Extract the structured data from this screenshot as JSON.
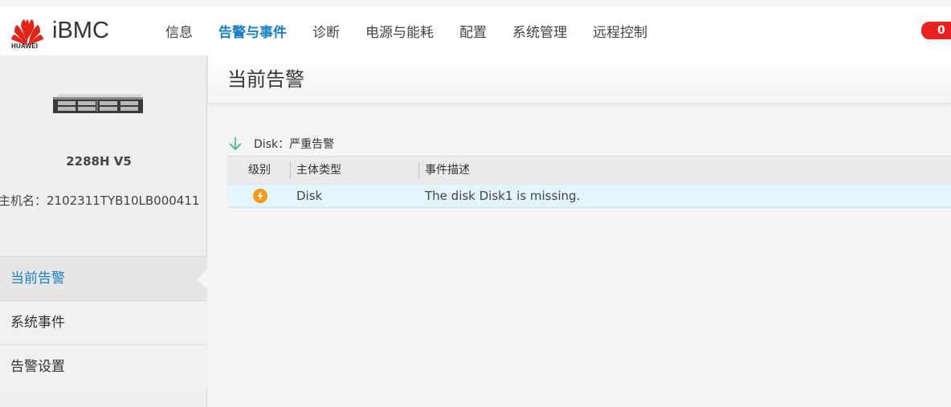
{
  "header": {
    "logo_text": "HUAWEI",
    "brand": "iBMC",
    "nav": [
      "信息",
      "告警与事件",
      "诊断",
      "电源与能耗",
      "配置",
      "系统管理",
      "远程控制"
    ],
    "active_nav": "告警与事件",
    "alert_count": "0"
  },
  "sidebar": {
    "model": "2288H V5",
    "hostname": "主机名：2102311TYB10LB000411",
    "items": [
      {
        "label": "当前告警"
      },
      {
        "label": "系统事件"
      },
      {
        "label": "告警设置"
      }
    ]
  },
  "main": {
    "title": "当前告警",
    "group_label": "Disk：严重告警",
    "columns": [
      "级别",
      "主体类型",
      "事件描述"
    ],
    "rows": [
      {
        "severity_icon": "critical-lightning-icon",
        "subject": "Disk",
        "description": "The disk Disk1 is missing."
      }
    ]
  },
  "colors": {
    "accent": "#1a7fc4",
    "badge": "#e8201f",
    "row_highlight": "#e3f4fb",
    "critical": "#f39a1e",
    "expand_arrow": "#3cb878"
  }
}
